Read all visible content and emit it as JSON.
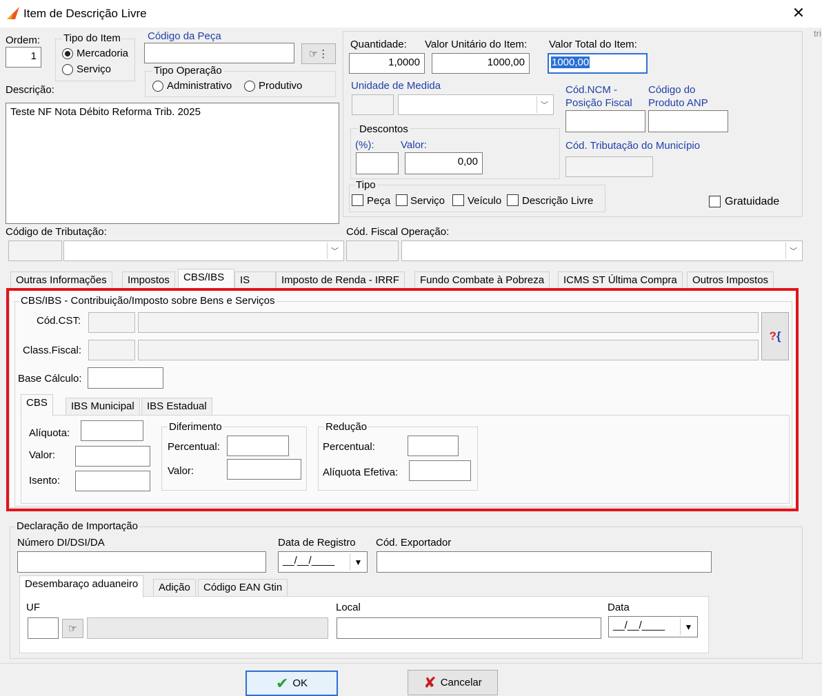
{
  "window": {
    "title": "Item de Descrição Livre",
    "close_glyph": "✕",
    "partial_right_text": "tri"
  },
  "header": {
    "ordem_label": "Ordem:",
    "ordem_value": "1",
    "tipo_item_label": "Tipo do Item",
    "mercadoria_label": "Mercadoria",
    "servico_label": "Serviço",
    "codigo_peca_label": "Código da Peça",
    "codigo_peca_value": "",
    "tipo_operacao_label": "Tipo Operação",
    "administrativo_label": "Administrativo",
    "produtivo_label": "Produtivo",
    "descricao_label": "Descrição:",
    "descricao_value": "Teste NF Nota Débito Reforma Trib. 2025"
  },
  "values": {
    "quantidade_label": "Quantidade:",
    "quantidade_value": "1,0000",
    "valor_unitario_label": "Valor Unitário do Item:",
    "valor_unitario_value": "1000,00",
    "valor_total_label": "Valor Total do Item:",
    "valor_total_value": "1000,00",
    "unidade_label": "Unidade de Medida",
    "ncm_label_1": "Cód.NCM -",
    "ncm_label_2": "Posição Fiscal",
    "anp_label_1": "Código do",
    "anp_label_2": "Produto ANP",
    "descontos_label": "Descontos",
    "perc_label": "(%):",
    "valor_label": "Valor:",
    "desconto_valor": "0,00",
    "trib_municipio_label": "Cód. Tributação do Município",
    "tipo_label": "Tipo",
    "peca_label": "Peça",
    "servico_label": "Serviço",
    "veiculo_label": "Veículo",
    "descricao_livre_label": "Descrição Livre",
    "gratuidade_label": "Gratuidade"
  },
  "codes": {
    "codigo_tributacao_label": "Código de Tributação:",
    "cfop_label": "Cód. Fiscal Operação:"
  },
  "tabs": {
    "outras": "Outras Informações",
    "impostos": "Impostos",
    "cbsibs": "CBS/IBS",
    "is": "IS",
    "irrf": "Imposto de Renda - IRRF",
    "fcp": "Fundo Combate à Pobreza",
    "icmsst": "ICMS ST Última Compra",
    "outros": "Outros Impostos"
  },
  "cbs": {
    "group_title": "CBS/IBS -  Contribuição/Imposto sobre Bens e Serviços",
    "cst_label": "Cód.CST:",
    "class_label": "Class.Fiscal:",
    "base_label": "Base Cálculo:",
    "sub_tabs": {
      "cbs": "CBS",
      "ibs_mun": "IBS Municipal",
      "ibs_est": "IBS Estadual"
    },
    "aliquota_label": "Alíquota:",
    "valor_label": "Valor:",
    "isento_label": "Isento:",
    "diferimento_title": "Diferimento",
    "dif_percentual_label": "Percentual:",
    "dif_valor_label": "Valor:",
    "reducao_title": "Redução",
    "red_percentual_label": "Percentual:",
    "red_aliquota_label": "Alíquota Efetiva:",
    "lookup_glyph_q": "?",
    "lookup_glyph_b": "{"
  },
  "import": {
    "group_title": "Declaração de Importação",
    "numero_label": "Número DI/DSI/DA",
    "data_registro_label": "Data de Registro",
    "data_registro_value": "__/__/____",
    "exportador_label": "Cód. Exportador",
    "sub_tabs": {
      "desembaraco": "Desembaraço aduaneiro",
      "adicao": "Adição",
      "ean": "Código EAN Gtin"
    },
    "uf_label": "UF",
    "local_label": "Local",
    "data_label": "Data",
    "data_value": "__/__/____"
  },
  "footer": {
    "ok_label": "OK",
    "cancel_label": "Cancelar"
  },
  "colors": {
    "highlight_border": "#e1141a",
    "label_blue": "#1f3fa8",
    "ok_check": "#2e9e2e",
    "cancel_x": "#c81e1e"
  }
}
